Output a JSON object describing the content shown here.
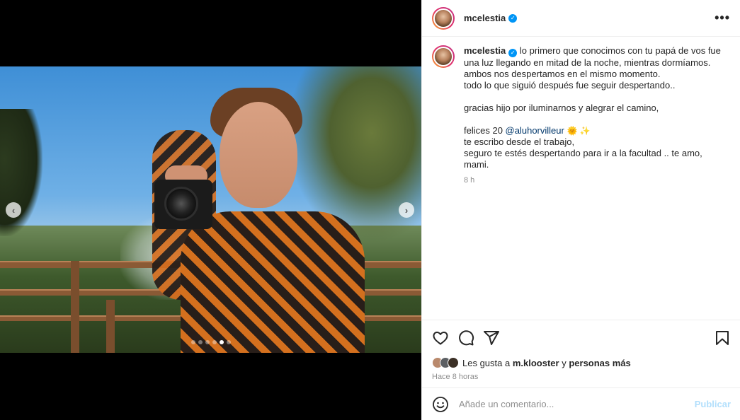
{
  "post": {
    "username": "mcelestia",
    "verified_symbol": "✓",
    "more_symbol": "•••",
    "caption_lines_1": [
      "lo primero que conocimos con tu papá de vos fue",
      "una luz llegando en mitad de la noche, mientras dormíamos.",
      "ambos nos despertamos en el mismo momento.",
      "todo lo que siguió después fue seguir despertando.."
    ],
    "caption_line_2": "gracias hijo por iluminarnos y alegrar el camino,",
    "caption_felices_prefix": "felices 20",
    "caption_mention": "@aluhorvilleur",
    "caption_emojis": "🌞 ✨",
    "caption_lines_3": [
      "te escribo desde el trabajo,",
      "seguro te estés despertando para ir a la facultad .. te amo, mami."
    ],
    "caption_time": "8 h",
    "likes_prefix": "Les gusta a",
    "likes_user": "m.klooster",
    "likes_and": "y",
    "likes_others": "personas más",
    "time_full": "Hace 8 horas",
    "comment_placeholder": "Añade un comentario...",
    "publish_label": "Publicar"
  },
  "carousel": {
    "prev_symbol": "‹",
    "next_symbol": "›",
    "total_slides": 6,
    "active_index": 4
  },
  "colors": {
    "accent_blue": "#0095f6",
    "mention_blue": "#00376b",
    "publish_disabled": "#b2dffc",
    "muted_text": "#8e8e8e"
  },
  "icons": [
    "heart-icon",
    "comment-icon",
    "share-icon",
    "bookmark-icon",
    "emoji-icon",
    "more-icon",
    "verified-icon"
  ]
}
